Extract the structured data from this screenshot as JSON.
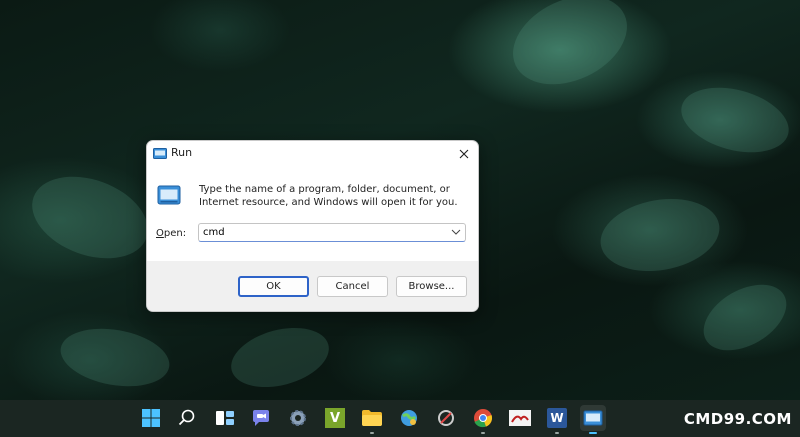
{
  "dialog": {
    "title": "Run",
    "description": "Type the name of a program, folder, document, or Internet resource, and Windows will open it for you.",
    "open_label_accesskey": "O",
    "open_label_rest": "pen:",
    "open_value": "cmd",
    "ok_label": "OK",
    "cancel_label": "Cancel",
    "browse_label": "Browse..."
  },
  "taskbar": {
    "icons": [
      "windows-start-icon",
      "search-icon",
      "task-view-icon",
      "chat-icon",
      "settings-icon",
      "app-v-icon",
      "file-explorer-icon",
      "control-panel-icon",
      "snipping-tool-icon",
      "chrome-icon",
      "photo-app-icon",
      "word-icon",
      "run-app-icon"
    ],
    "app_v_letter": "V",
    "word_letter": "W"
  },
  "watermark": "CMD99.COM",
  "colors": {
    "accent": "#2e63c8",
    "dialog_bg": "#ffffff",
    "footer_bg": "#f0f0f0",
    "taskbar_bg": "#1b2622"
  }
}
